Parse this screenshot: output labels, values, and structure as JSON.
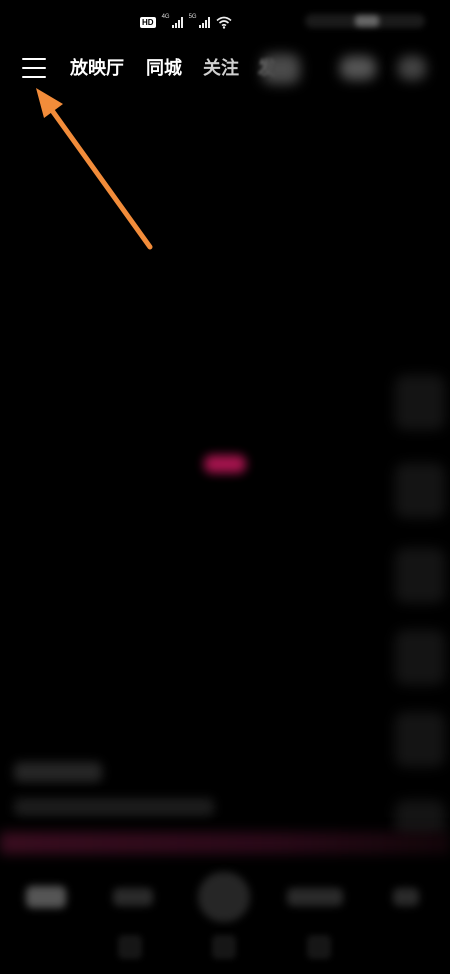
{
  "status_bar": {
    "hd_label": "HD",
    "network_1": "4G",
    "network_2": "5G"
  },
  "top_nav": {
    "tabs": [
      {
        "label": "放映厅"
      },
      {
        "label": "同城"
      },
      {
        "label": "关注"
      },
      {
        "label": "发"
      }
    ]
  },
  "icons": [
    "menu-icon",
    "search-icon",
    "live-icon",
    "wifi-icon",
    "signal-icon"
  ],
  "colors": {
    "background": "#000000",
    "annotation_arrow": "#F28C3A",
    "accent_pink": "#C2185B"
  }
}
